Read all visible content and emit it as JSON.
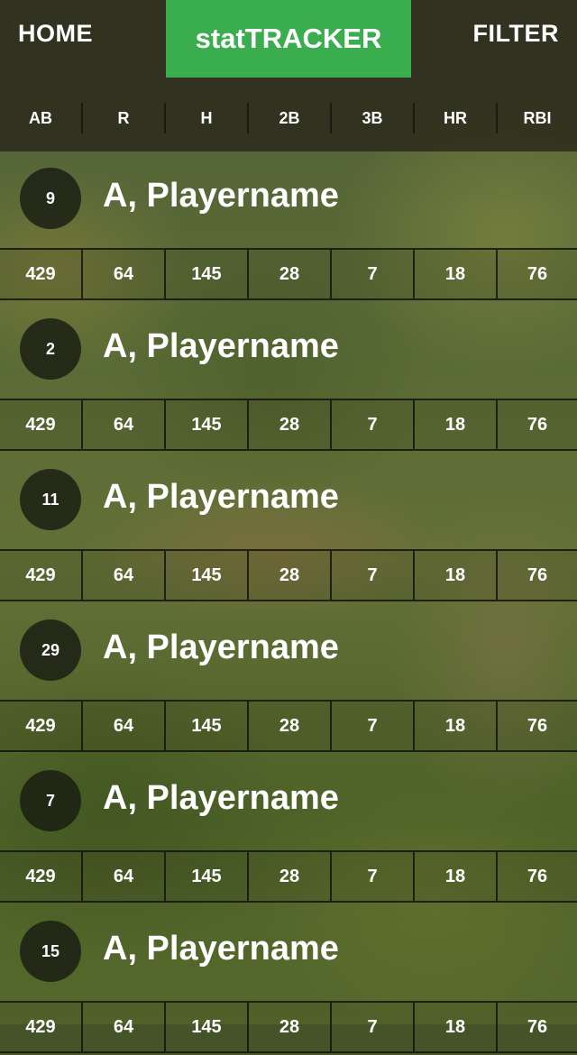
{
  "nav": {
    "home_label": "HOME",
    "title": "statTRACKER",
    "filter_label": "FILTER",
    "brand_color": "#3aad4e"
  },
  "columns": [
    "AB",
    "R",
    "H",
    "2B",
    "3B",
    "HR",
    "RBI"
  ],
  "players": [
    {
      "number": "9",
      "name": "A, Playername",
      "stats": [
        "429",
        "64",
        "145",
        "28",
        "7",
        "18",
        "76"
      ]
    },
    {
      "number": "2",
      "name": "A, Playername",
      "stats": [
        "429",
        "64",
        "145",
        "28",
        "7",
        "18",
        "76"
      ]
    },
    {
      "number": "11",
      "name": "A, Playername",
      "stats": [
        "429",
        "64",
        "145",
        "28",
        "7",
        "18",
        "76"
      ]
    },
    {
      "number": "29",
      "name": "A, Playername",
      "stats": [
        "429",
        "64",
        "145",
        "28",
        "7",
        "18",
        "76"
      ]
    },
    {
      "number": "7",
      "name": "A, Playername",
      "stats": [
        "429",
        "64",
        "145",
        "28",
        "7",
        "18",
        "76"
      ]
    },
    {
      "number": "15",
      "name": "A, Playername",
      "stats": [
        "429",
        "64",
        "145",
        "28",
        "7",
        "18",
        "76"
      ]
    }
  ]
}
